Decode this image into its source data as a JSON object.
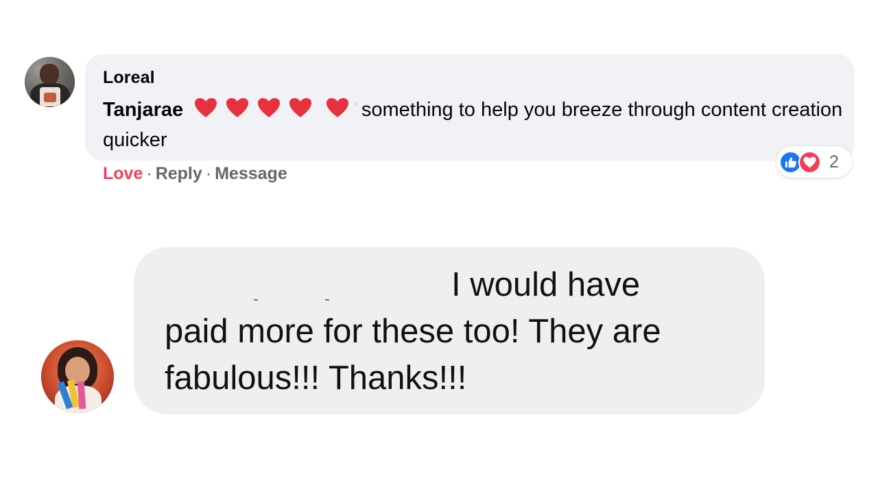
{
  "comment1": {
    "author": "Loreal",
    "mention": "Tanjarae",
    "body": "something to help you breeze through content creation quicker",
    "actions": {
      "love": "Love",
      "reply": "Reply",
      "message": "Message",
      "separator": "·"
    },
    "reactions": {
      "icons": [
        "like-icon",
        "love-icon"
      ],
      "count": "2"
    },
    "colors": {
      "bubble": "#f0f2f5",
      "love": "#f33e58",
      "action": "#65676b",
      "like": "#1877f2"
    }
  },
  "comment2": {
    "line1": "I would have",
    "line2": "paid more for these too! They are",
    "line3": "fabulous!!! Thanks!!!",
    "colors": {
      "bubble": "#efeff0"
    }
  }
}
